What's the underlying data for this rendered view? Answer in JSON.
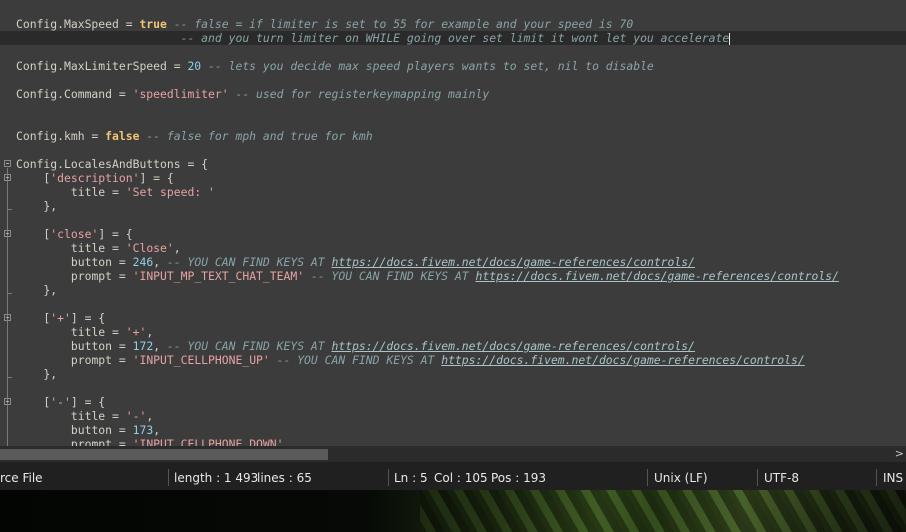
{
  "editor": {
    "lines": [
      {
        "tokens": [
          [
            "ident",
            "Config.MaxSpeed"
          ],
          [
            "op",
            " = "
          ],
          [
            "kw",
            "true"
          ],
          [
            "cmt",
            " -- false = if limiter is set to 55 for example and your speed is 70"
          ]
        ]
      },
      {
        "current": true,
        "caret": true,
        "tokens": [
          [
            "op",
            "                        "
          ],
          [
            "cmt",
            "-- and you turn limiter on WHILE going over set limit it wont let you accelerate"
          ]
        ]
      },
      {
        "tokens": []
      },
      {
        "tokens": [
          [
            "ident",
            "Config.MaxLimiterSpeed"
          ],
          [
            "op",
            " = "
          ],
          [
            "num",
            "20"
          ],
          [
            "cmt",
            " -- lets you decide max speed players wants to set, nil to disable"
          ]
        ]
      },
      {
        "tokens": []
      },
      {
        "tokens": [
          [
            "ident",
            "Config.Command"
          ],
          [
            "op",
            " = "
          ],
          [
            "str",
            "'speedlimiter'"
          ],
          [
            "cmt",
            " -- used for registerkeymapping mainly"
          ]
        ]
      },
      {
        "tokens": []
      },
      {
        "tokens": []
      },
      {
        "tokens": [
          [
            "ident",
            "Config.kmh"
          ],
          [
            "op",
            " = "
          ],
          [
            "kw",
            "false"
          ],
          [
            "cmt",
            " -- false for mph and true for kmh"
          ]
        ]
      },
      {
        "tokens": []
      },
      {
        "tokens": [
          [
            "ident",
            "Config.LocalesAndButtons"
          ],
          [
            "op",
            " = {"
          ]
        ]
      },
      {
        "tokens": [
          [
            "op",
            "    ["
          ],
          [
            "str",
            "'description'"
          ],
          [
            "op",
            "] = {"
          ]
        ]
      },
      {
        "tokens": [
          [
            "op",
            "        "
          ],
          [
            "ident",
            "title"
          ],
          [
            "op",
            " = "
          ],
          [
            "str",
            "'Set speed: '"
          ]
        ]
      },
      {
        "tokens": [
          [
            "op",
            "    },"
          ]
        ]
      },
      {
        "tokens": []
      },
      {
        "tokens": [
          [
            "op",
            "    ["
          ],
          [
            "str",
            "'close'"
          ],
          [
            "op",
            "] = {"
          ]
        ]
      },
      {
        "tokens": [
          [
            "op",
            "        "
          ],
          [
            "ident",
            "title"
          ],
          [
            "op",
            " = "
          ],
          [
            "str",
            "'Close'"
          ],
          [
            "op",
            ","
          ]
        ]
      },
      {
        "tokens": [
          [
            "op",
            "        "
          ],
          [
            "ident",
            "button"
          ],
          [
            "op",
            " = "
          ],
          [
            "num",
            "246"
          ],
          [
            "op",
            ", "
          ],
          [
            "cmt",
            "-- YOU CAN FIND KEYS AT "
          ],
          [
            "link",
            "https://docs.fivem.net/docs/game-references/controls/"
          ]
        ]
      },
      {
        "tokens": [
          [
            "op",
            "        "
          ],
          [
            "ident",
            "prompt"
          ],
          [
            "op",
            " = "
          ],
          [
            "str",
            "'INPUT_MP_TEXT_CHAT_TEAM'"
          ],
          [
            "cmt",
            " -- YOU CAN FIND KEYS AT "
          ],
          [
            "link",
            "https://docs.fivem.net/docs/game-references/controls/"
          ]
        ]
      },
      {
        "tokens": [
          [
            "op",
            "    },"
          ]
        ]
      },
      {
        "tokens": []
      },
      {
        "tokens": [
          [
            "op",
            "    ["
          ],
          [
            "str",
            "'+'"
          ],
          [
            "op",
            "] = {"
          ]
        ]
      },
      {
        "tokens": [
          [
            "op",
            "        "
          ],
          [
            "ident",
            "title"
          ],
          [
            "op",
            " = "
          ],
          [
            "str",
            "'+'"
          ],
          [
            "op",
            ","
          ]
        ]
      },
      {
        "tokens": [
          [
            "op",
            "        "
          ],
          [
            "ident",
            "button"
          ],
          [
            "op",
            " = "
          ],
          [
            "num",
            "172"
          ],
          [
            "op",
            ", "
          ],
          [
            "cmt",
            "-- YOU CAN FIND KEYS AT "
          ],
          [
            "link",
            "https://docs.fivem.net/docs/game-references/controls/"
          ]
        ]
      },
      {
        "tokens": [
          [
            "op",
            "        "
          ],
          [
            "ident",
            "prompt"
          ],
          [
            "op",
            " = "
          ],
          [
            "str",
            "'INPUT_CELLPHONE_UP'"
          ],
          [
            "cmt",
            " -- YOU CAN FIND KEYS AT "
          ],
          [
            "link",
            "https://docs.fivem.net/docs/game-references/controls/"
          ]
        ]
      },
      {
        "tokens": [
          [
            "op",
            "    },"
          ]
        ]
      },
      {
        "tokens": []
      },
      {
        "tokens": [
          [
            "op",
            "    ["
          ],
          [
            "str",
            "'-'"
          ],
          [
            "op",
            "] = {"
          ]
        ]
      },
      {
        "tokens": [
          [
            "op",
            "        "
          ],
          [
            "ident",
            "title"
          ],
          [
            "op",
            " = "
          ],
          [
            "str",
            "'-'"
          ],
          [
            "op",
            ","
          ]
        ]
      },
      {
        "tokens": [
          [
            "op",
            "        "
          ],
          [
            "ident",
            "button"
          ],
          [
            "op",
            " = "
          ],
          [
            "num",
            "173"
          ],
          [
            "op",
            ","
          ]
        ]
      },
      {
        "tokens": [
          [
            "op",
            "        "
          ],
          [
            "ident",
            "prompt"
          ],
          [
            "op",
            " = "
          ],
          [
            "str",
            "'INPUT_CELLPHONE_DOWN'"
          ]
        ]
      }
    ]
  },
  "hscroll": {
    "right_arrow_icon": "chevron-right-icon",
    "arrow_glyph": ">"
  },
  "status": {
    "file_type": "rce File",
    "length": "length : 1 493",
    "lines": "lines : 65",
    "ln": "Ln : 5",
    "col": "Col : 105",
    "pos": "Pos : 193",
    "eol": "Unix (LF)",
    "encoding": "UTF-8",
    "mode": "INS"
  },
  "colors": {
    "background": "#3c3c3c",
    "current_line": "#2a2a2a",
    "keyword": "#f0c674",
    "number": "#8fcfe8",
    "string": "#e6a2a2",
    "comment": "#8aa3a8",
    "statusbar": "#202020"
  }
}
